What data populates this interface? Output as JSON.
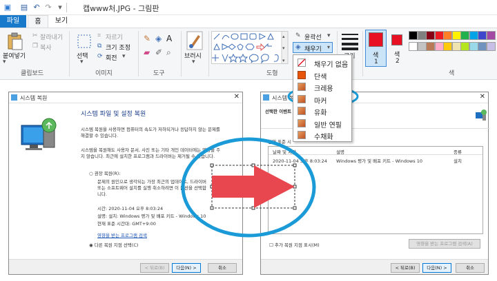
{
  "app": {
    "title": "캡www처.JPG - 그림판"
  },
  "tabs": {
    "file": "파일",
    "home": "홈",
    "view": "보기"
  },
  "ribbon": {
    "clipboard": {
      "paste": "붙여넣기",
      "cut": "잘라내기",
      "copy": "복사",
      "label": "클립보드"
    },
    "image": {
      "select": "선택",
      "crop": "자르기",
      "resize": "크기 조정",
      "rotate": "회전",
      "label": "이미지"
    },
    "tools": {
      "label": "도구"
    },
    "brushes": {
      "label": "브러시"
    },
    "shapes": {
      "outline": "윤곽선",
      "fill": "채우기",
      "label": "도형"
    },
    "size": {
      "label": "크기"
    },
    "colors": {
      "color1": "색",
      "color1_num": "1",
      "color2": "색",
      "color2_num": "2",
      "label": "색",
      "color1_hex": "#e81123",
      "color2_hex": "#e81123",
      "palette": [
        "#000000",
        "#7f7f7f",
        "#880015",
        "#ed1c24",
        "#ff7f27",
        "#fff200",
        "#22b14c",
        "#00a2e8",
        "#3f48cc",
        "#a349a4",
        "#ffffff",
        "#c3c3c3",
        "#b97a57",
        "#ffaec9",
        "#ffc90e",
        "#efe4b0",
        "#b5e61d",
        "#99d9ea",
        "#7092be",
        "#c8bfe7"
      ]
    }
  },
  "fill_menu": {
    "items": [
      {
        "label": "채우기 없음",
        "swatch": "none"
      },
      {
        "label": "단색",
        "swatch": "#e8540a"
      },
      {
        "label": "크레용",
        "swatch": "crayon"
      },
      {
        "label": "마커",
        "swatch": "marker"
      },
      {
        "label": "유화",
        "swatch": "oil"
      },
      {
        "label": "일반 연필",
        "swatch": "pencil"
      },
      {
        "label": "수채화",
        "swatch": "water"
      }
    ]
  },
  "left_dialog": {
    "title": "시스템 복원",
    "heading": "시스템 파일 및 설정 복원",
    "para1_line1": "시스템 복원을 사용하면 컴퓨터의 속도가 저하되거나 응답하지 않는 문제를",
    "para1_line2": "해결할 수 있습니다.",
    "para2_line1": "시스템을 복원해도 사용자 문서, 사진 또는 기타 개인 데이터에는 영향을 주",
    "para2_line2": "지 않습니다. 최근에 설치한 프로그램과 드라이버는 제거될 수 있습니다.",
    "radio1": "권장 복원(R):",
    "radio1_line1": "문제의 원인으로 생각되는 가장 최근의 업데이트, 드라이버",
    "radio1_line2": "또는 소프트웨어 설치를 실행 취소하려면 이 옵션을 선택합",
    "radio1_line3": "니다.",
    "time": "시간: 2020-11-04 오후 8:03:24",
    "desc": "설명: 설치: Windows 평가 및 배포 키트 - Windows 10",
    "tz": "현재 표준 시간대: GMT+9:00",
    "link": "영향을 받는 프로그램 검색",
    "radio2": "다른 복원 지점 선택(C)",
    "back": "< 뒤로(B)",
    "next": "다음(N) >",
    "cancel": "취소"
  },
  "right_dialog": {
    "title": "시스템 복원",
    "subtitle": "선택한 이벤트",
    "tz_label": "현재 표준 시",
    "col_date": "날짜 및 시간",
    "col_desc": "설명",
    "col_type": "종류",
    "row_date": "2020-11-04 오후 8:03:24",
    "row_desc": "Windows 평가 및 배포 키트 - Windows 10",
    "row_type": "설치",
    "more": "추가 복원 지점 표시(M)",
    "scan": "영향을 받는 프로그램 검색(A)",
    "back": "< 뒤로(B)",
    "next": "다음(N) >",
    "cancel": "취소"
  }
}
